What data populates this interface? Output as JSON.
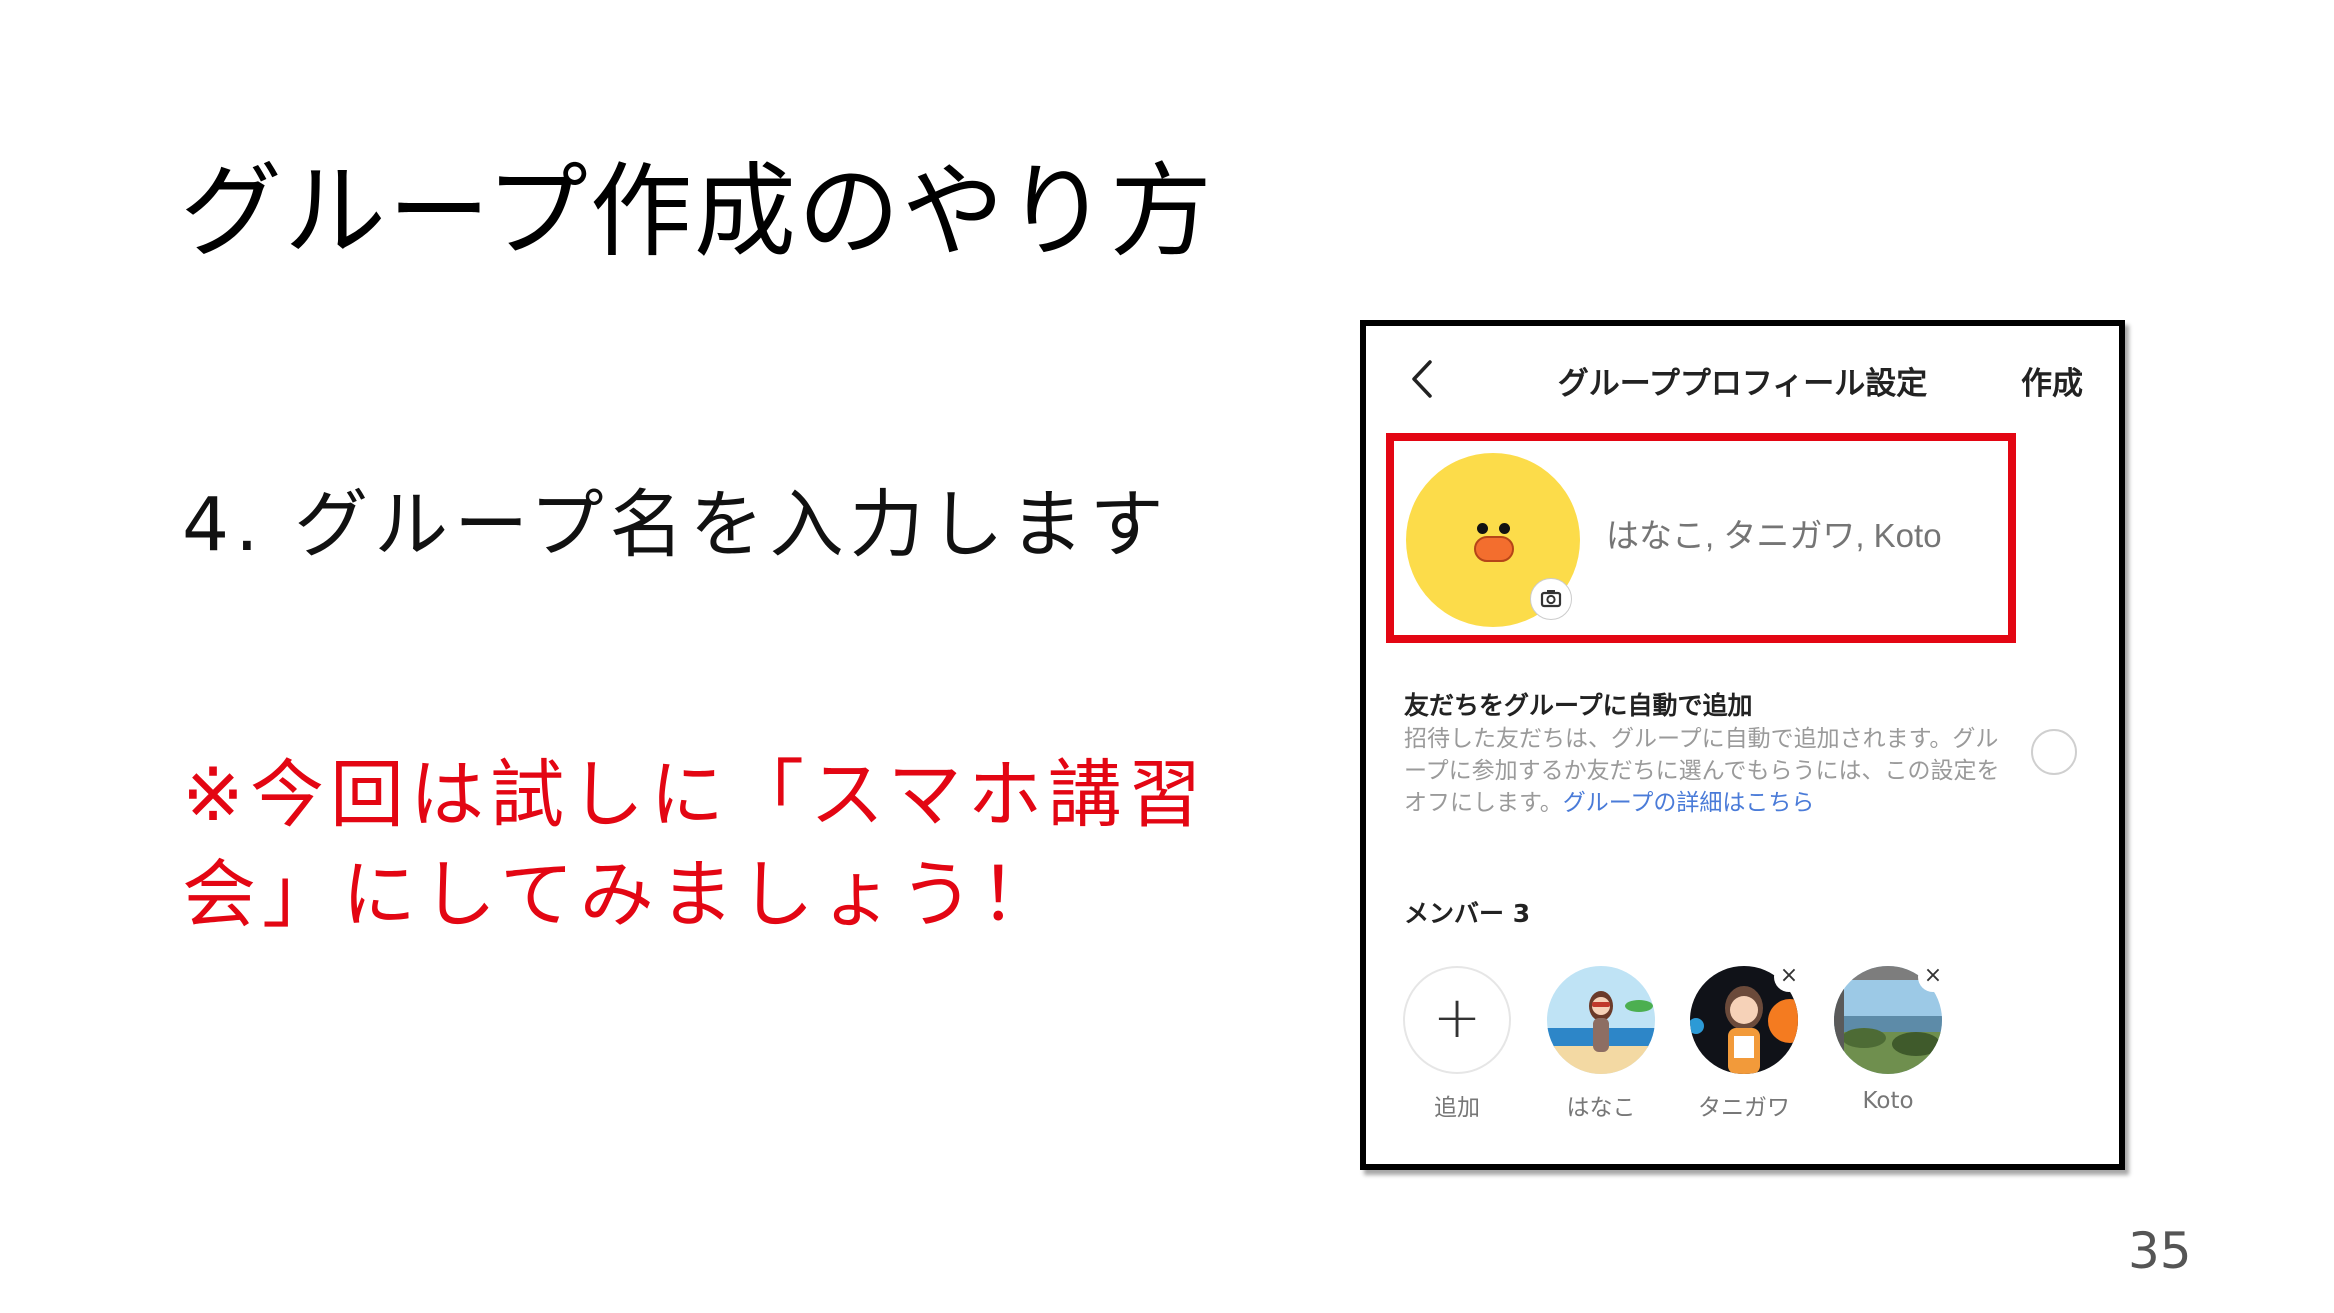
{
  "slide": {
    "title": "グループ作成のやり方",
    "step": "4. グループ名を入力します",
    "note": "※今回は試しに「スマホ講習会」にしてみましょう！",
    "page_number": "35"
  },
  "phone": {
    "header_title": "グループプロフィール設定",
    "create_label": "作成",
    "name_placeholder": "はなこ, タニガワ, Koto",
    "auto_add": {
      "title": "友だちをグループに自動で追加",
      "description": "招待した友だちは、グループに自動で追加されます。グループに参加するか友だちに選んでもらうには、この設定をオフにします。",
      "link": "グループの詳細はこちら"
    },
    "members_label": "メンバー 3",
    "members": [
      {
        "name": "追加",
        "icon": "plus-icon"
      },
      {
        "name": "はなこ",
        "icon": "avatar-beach"
      },
      {
        "name": "タニガワ",
        "icon": "avatar-dark"
      },
      {
        "name": "Koto",
        "icon": "avatar-landscape"
      }
    ],
    "remove_symbol": "×"
  },
  "colors": {
    "highlight": "#e30613",
    "note_text": "#e30613",
    "avatar_yellow": "#fcdc4a",
    "link": "#4a7bd8"
  }
}
